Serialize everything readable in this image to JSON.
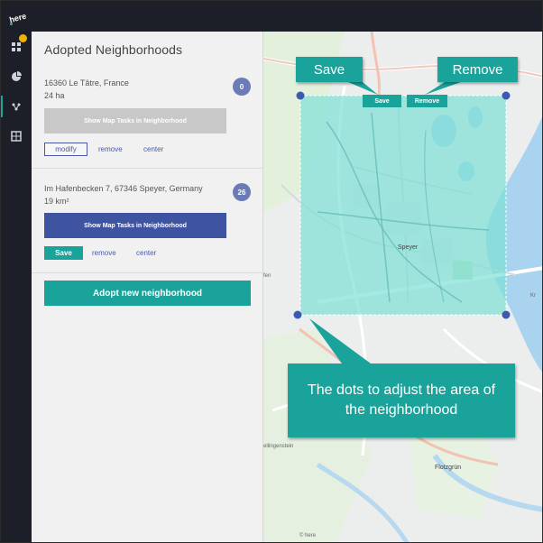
{
  "app": {
    "logo_text": "here"
  },
  "rail": {
    "icons": [
      "dashboard-icon",
      "chart-icon",
      "routes-icon",
      "map-grid-icon"
    ]
  },
  "panel": {
    "title": "Adopted Neighborhoods",
    "neighborhoods": [
      {
        "address": "16360 Le Tâtre, France",
        "size": "24 ha",
        "task_count": "0",
        "tasks_button": "Show Map Tasks in Neighborhood",
        "actions": [
          "modify",
          "remove",
          "center"
        ]
      },
      {
        "address": "Im Hafenbecken 7, 67346 Speyer, Germany",
        "size": "19 km²",
        "task_count": "26",
        "tasks_button": "Show Map Tasks in Neighborhood",
        "actions": [
          "Save",
          "remove",
          "center"
        ]
      }
    ],
    "adopt_button": "Adopt new neighborhood"
  },
  "map": {
    "labels": {
      "city": "Speyer",
      "west": "fen",
      "east": "Kr",
      "southwest": "ellingenstein",
      "south": "Flotzgrün",
      "copyright": "© here"
    },
    "polygon_save": "Save",
    "polygon_remove": "Remove"
  },
  "callouts": {
    "save": "Save",
    "remove": "Remove",
    "dots": "The dots to adjust the area of the neighborhood"
  },
  "colors": {
    "accent": "#1aa39a",
    "primary": "#3f54a0",
    "sidebar": "#1c1f27",
    "polygon_fill": "#7ee0d6"
  }
}
